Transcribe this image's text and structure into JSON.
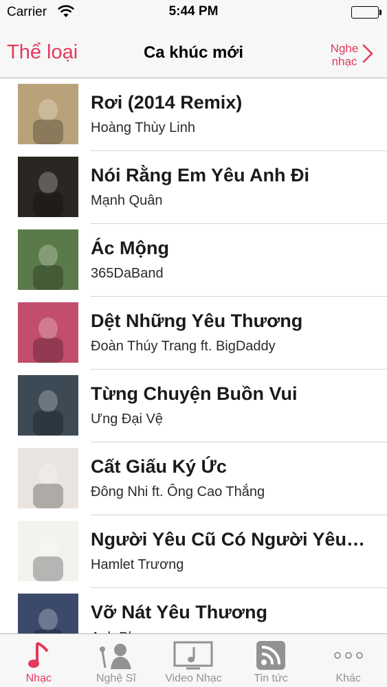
{
  "status_bar": {
    "carrier": "Carrier",
    "time": "5:44 PM"
  },
  "nav": {
    "left_label": "Thể loại",
    "title": "Ca khúc mới",
    "right_label": "Nghe\nnhạc"
  },
  "songs": [
    {
      "title": "Rơi (2014 Remix)",
      "artist": "Hoàng Thùy Linh",
      "art_color": "#b9a27a"
    },
    {
      "title": "Nói Rằng Em Yêu Anh Đi",
      "artist": "Mạnh Quân",
      "art_color": "#2a2622"
    },
    {
      "title": "Ác Mộng",
      "artist": "365DaBand",
      "art_color": "#5b7a4a"
    },
    {
      "title": "Dệt Những Yêu Thương",
      "artist": "Đoàn Thúy Trang  ft. BigDaddy",
      "art_color": "#c24e6c"
    },
    {
      "title": "Từng Chuyện Buồn Vui",
      "artist": "Ưng Đại Vệ",
      "art_color": "#3c4a55"
    },
    {
      "title": "Cất Giấu Ký Ức",
      "artist": "Đông Nhi  ft. Ông Cao Thắng",
      "art_color": "#e9e4df"
    },
    {
      "title": "Người Yêu Cũ Có Người Yêu Mới",
      "artist": "Hamlet Trương",
      "art_color": "#f2f2ef"
    },
    {
      "title": "Vỡ Nát Yêu Thương",
      "artist": "Anh Phong",
      "art_color": "#3b4a6b"
    }
  ],
  "tabs": [
    {
      "label": "Nhạc",
      "icon": "music-note-icon",
      "active": true
    },
    {
      "label": "Nghệ Sĩ",
      "icon": "singer-icon",
      "active": false
    },
    {
      "label": "Video Nhạc",
      "icon": "video-icon",
      "active": false
    },
    {
      "label": "Tin tức",
      "icon": "rss-icon",
      "active": false
    },
    {
      "label": "Khác",
      "icon": "more-icon",
      "active": false
    }
  ],
  "colors": {
    "accent": "#e23a5c",
    "tab_inactive": "#929292",
    "separator": "#d4d4d4"
  }
}
